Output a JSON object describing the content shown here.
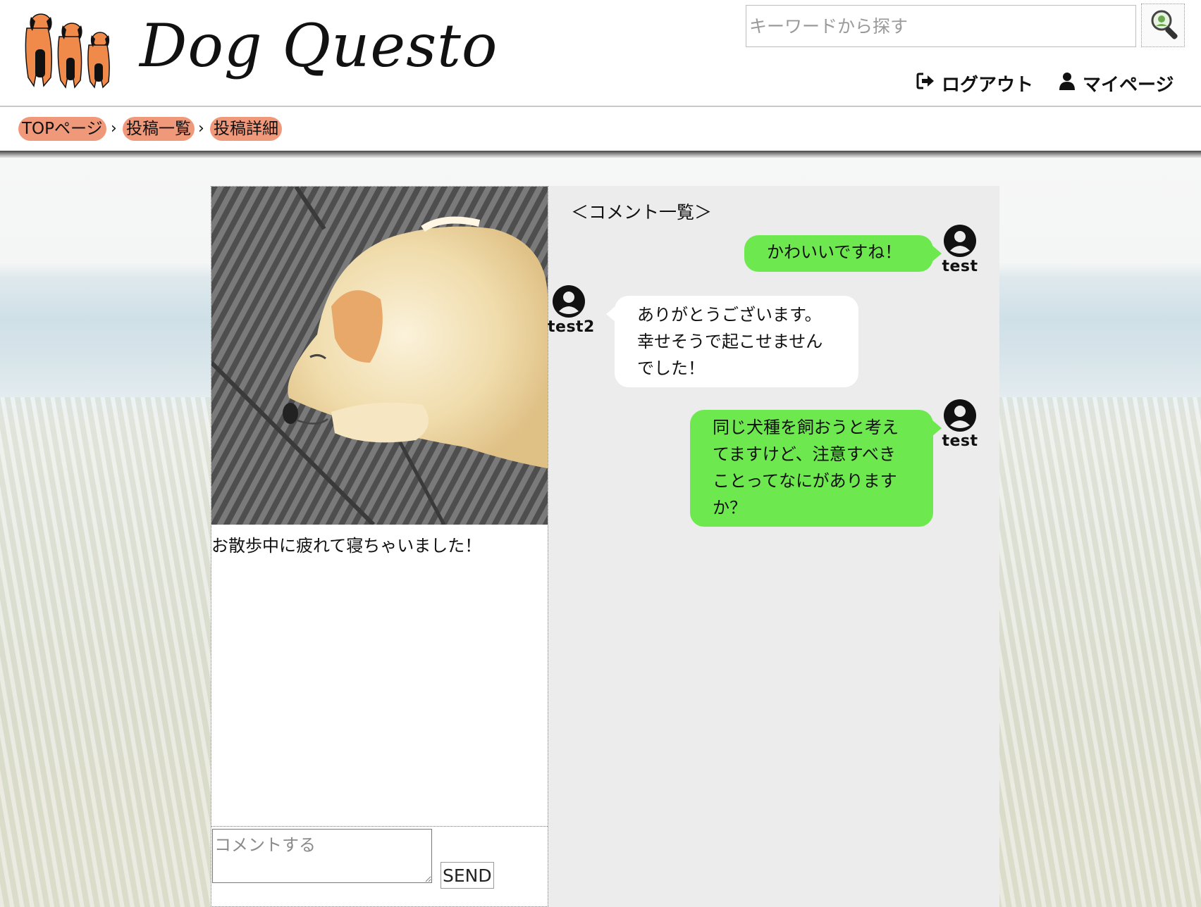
{
  "header": {
    "logo_text": "Dog Questo",
    "search_placeholder": "キーワードから探す",
    "logout_label": "ログアウト",
    "mypage_label": "マイページ"
  },
  "breadcrumb": {
    "items": [
      "TOPページ",
      "投稿一覧",
      "投稿詳細"
    ],
    "separator": "›"
  },
  "post": {
    "caption": "お散歩中に疲れて寝ちゃいました！"
  },
  "comment_form": {
    "placeholder": "コメントする",
    "send_label": "SEND"
  },
  "comments": {
    "title": "＜コメント一覧＞",
    "items": [
      {
        "user": "test",
        "side": "right",
        "lines": [
          "かわいいですね！"
        ]
      },
      {
        "user": "test2",
        "side": "left",
        "lines": [
          "ありがとうございます。",
          "幸せそうで起こせません",
          "でした！"
        ]
      },
      {
        "user": "test",
        "side": "right",
        "lines": [
          "同じ犬種を飼おうと考え",
          "てますけど、注意すべき",
          "ことってなにがあります",
          "か？"
        ]
      }
    ]
  },
  "colors": {
    "accent_crumb": "#f0987a",
    "bubble_mine": "#6ee84f",
    "bubble_other": "#ffffff",
    "comments_bg": "#ececec",
    "logo_dog": "#f08a4b"
  },
  "icons": [
    "dog-logo-icon",
    "search-icon",
    "logout-icon",
    "user-icon",
    "avatar-icon"
  ]
}
